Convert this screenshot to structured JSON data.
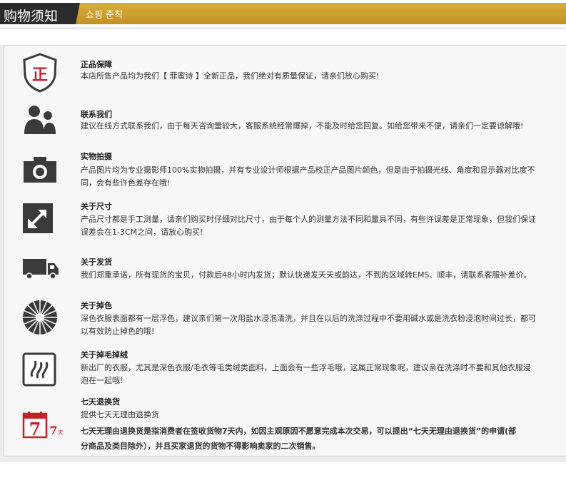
{
  "header": {
    "title": "购物须知",
    "subtitle": "쇼핑 준칙"
  },
  "items": [
    {
      "icon": "shield-icon",
      "icon_text": "正",
      "title": "正品保障",
      "lines": [
        "本店所售产品均为我们【 菲蜜诗 】全新正品，我们绝对有质量保证，请亲们放心购买!"
      ]
    },
    {
      "icon": "users-icon",
      "title": "联系我们",
      "lines": [
        "建议在线方式联系我们，由于每天咨询量较大，客服系统经常爆掉，不能及时给您回复。如给您带来不便，请亲们一定要谅解哦!"
      ]
    },
    {
      "icon": "camera-icon",
      "title": "实物拍摄",
      "lines": [
        "产品图片均为专业摄影师100%实物拍摄，并有专业设计师根据产品校正产品图片颜色，但是由于拍摄光线、角度和显示器对比度不",
        "同，会有些许色差存在哦!"
      ]
    },
    {
      "icon": "resize-arrow-icon",
      "title": "关于尺寸",
      "lines": [
        "产品尺寸都是手工测量，请亲们购买时仔细对比尺寸，由于每个人的测量方法不同和量具不同，有些许误差是正常现象，但我们保证",
        "误差会在1-3CM之间，请放心购买!"
      ]
    },
    {
      "icon": "truck-icon",
      "title": "关于发货",
      "lines": [
        "我们郑重承诺，所有现货的宝贝，付款后48小时内发货；默认快递发天天或韵达，不到的区域转EMS、顺丰，请联系客服补差价。"
      ]
    },
    {
      "icon": "color-fade-icon",
      "title": "关于掉色",
      "lines": [
        "深色衣服表面都有一层浮色，建议亲们第一次用盐水浸泡清洗，并且在以后的洗涤过程中不要用碱水或是洗衣粉浸泡时间过长，都可",
        "以有效防止掉色的哦!"
      ]
    },
    {
      "icon": "fluff-icon",
      "title": "关于掉毛掉绒",
      "lines": [
        "新出厂的衣服，尤其是深色衣服/毛衣等毛类绒类面料，上面会有一些浮毛哦，这属正常现象呢，建议亲在洗涤时不要和其他衣服浸",
        "泡在一起哦!"
      ]
    },
    {
      "icon": "calendar-7-icon",
      "icon_text": "7",
      "icon_text2": "7",
      "icon_text3": "天",
      "title": "七天退换货",
      "lines": [
        "提供七天无理由退换货",
        "七天无理由退换货是指消费者在签收货物7天内，如因主观原因不愿意完成本次交易，可以提出“七天无理由退换货”的申请(部",
        "分商品及类目除外），并且买家退货的货物不得影响卖家的二次销售。"
      ]
    }
  ],
  "colors": {
    "header_gold": "#c9982a",
    "title_bg": "#2b2b2b",
    "icon_dark": "#3a3a3a",
    "accent_red": "#c0242a"
  }
}
